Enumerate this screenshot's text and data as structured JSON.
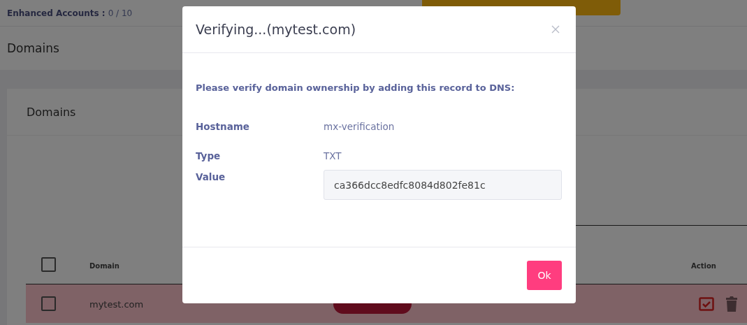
{
  "top_bar": {
    "label": "Enhanced Accounts :",
    "value": "0 / 10"
  },
  "page_header": {
    "title": "Domains"
  },
  "card": {
    "title": "Domains",
    "table": {
      "header_checked": false,
      "columns": [
        "Domain",
        "Action"
      ],
      "rows": [
        {
          "domain": "mytest.com",
          "checked": false,
          "flagged": true
        }
      ]
    }
  },
  "modal": {
    "title": "Verifying...(mytest.com)",
    "instruction": "Please verify domain ownership by adding this record to DNS:",
    "fields": [
      {
        "label": "Hostname",
        "value": "mx-verification",
        "kind": "text"
      },
      {
        "label": "Type",
        "value": "TXT",
        "kind": "text"
      },
      {
        "label": "Value",
        "value": "ca366dcc8edfc8084d802fe81c",
        "kind": "field"
      }
    ],
    "button": "Ok"
  }
}
